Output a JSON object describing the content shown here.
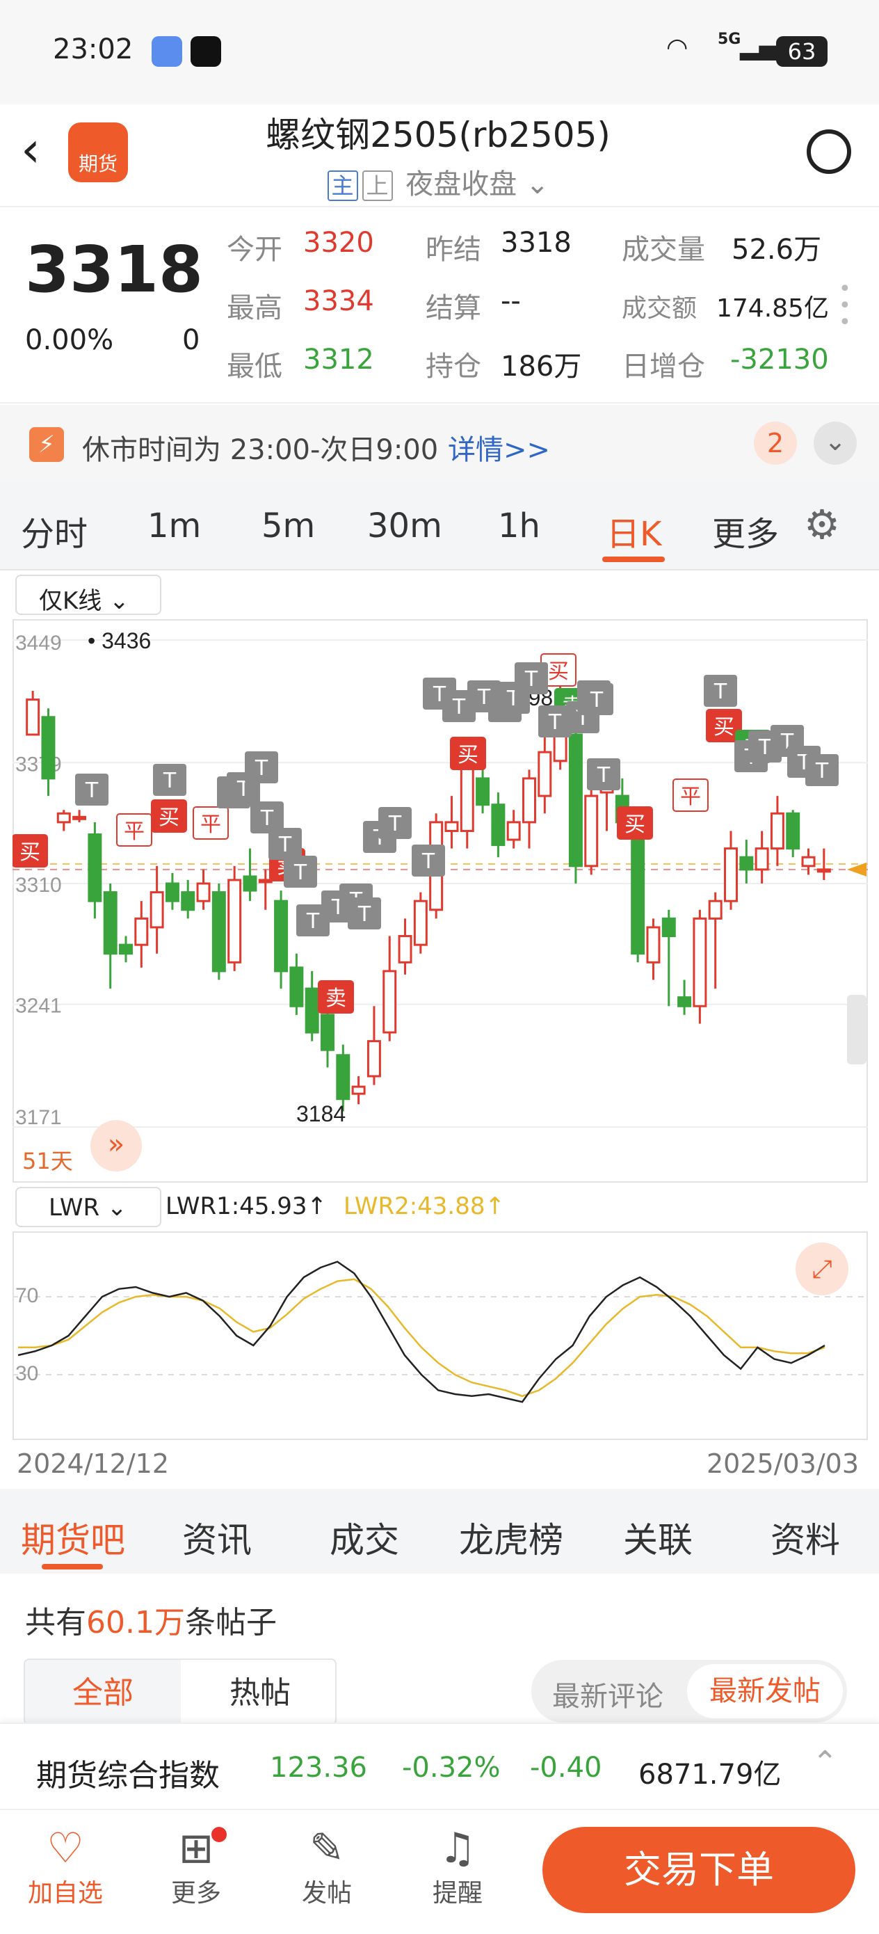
{
  "status": {
    "time": "23:02",
    "battery": "63",
    "network": "5G"
  },
  "header": {
    "title": "螺纹钢2505(rb2505)",
    "tag_main": "主",
    "tag_up": "上",
    "session": "夜盘收盘",
    "logo_text": "期货"
  },
  "quote": {
    "price": "3318",
    "change_pct": "0.00%",
    "change": "0",
    "open_label": "今开",
    "open": "3320",
    "prev_label": "昨结",
    "prev": "3318",
    "vol_label": "成交量",
    "vol": "52.6万",
    "high_label": "最高",
    "high": "3334",
    "settle_label": "结算",
    "settle": "--",
    "amt_label": "成交额",
    "amt": "174.85亿",
    "low_label": "最低",
    "low": "3312",
    "oi_label": "持仓",
    "oi": "186万",
    "oichg_label": "日增仓",
    "oichg": "-32130"
  },
  "notice": {
    "text": "休市时间为 23:00-次日9:00",
    "link": "详情>>",
    "badge": "2"
  },
  "period_tabs": [
    "分时",
    "1m",
    "5m",
    "30m",
    "1h",
    "日K",
    "更多"
  ],
  "chart_mode": "仅K线",
  "chart_data": {
    "type": "candlestick",
    "y_ticks": [
      "3449",
      "3379",
      "3310",
      "3241",
      "3171"
    ],
    "ylim": [
      3171,
      3449
    ],
    "high_label": "3436",
    "low_label": "3184",
    "mid_label": "3398",
    "days": "51天",
    "markers": [
      "买",
      "卖",
      "平",
      "T"
    ],
    "candles": [
      [
        3395,
        3415,
        3420,
        3400
      ],
      [
        3405,
        3370,
        3410,
        3360
      ],
      [
        3345,
        3350,
        3352,
        3340
      ],
      [
        3348,
        3348,
        3352,
        3345
      ],
      [
        3338,
        3300,
        3345,
        3290
      ],
      [
        3305,
        3270,
        3310,
        3250
      ],
      [
        3275,
        3270,
        3280,
        3265
      ],
      [
        3275,
        3290,
        3300,
        3262
      ],
      [
        3285,
        3305,
        3320,
        3270
      ],
      [
        3310,
        3300,
        3316,
        3295
      ],
      [
        3305,
        3295,
        3312,
        3290
      ],
      [
        3300,
        3310,
        3318,
        3295
      ],
      [
        3305,
        3260,
        3310,
        3255
      ],
      [
        3265,
        3312,
        3320,
        3260
      ],
      [
        3314,
        3306,
        3330,
        3300
      ],
      [
        3312,
        3312,
        3318,
        3295
      ],
      [
        3300,
        3260,
        3306,
        3250
      ],
      [
        3262,
        3240,
        3270,
        3235
      ],
      [
        3250,
        3225,
        3260,
        3220
      ],
      [
        3235,
        3215,
        3244,
        3205
      ],
      [
        3212,
        3187,
        3218,
        3180
      ],
      [
        3190,
        3194,
        3200,
        3184
      ],
      [
        3200,
        3220,
        3240,
        3195
      ],
      [
        3225,
        3260,
        3280,
        3220
      ],
      [
        3265,
        3280,
        3290,
        3258
      ],
      [
        3275,
        3300,
        3305,
        3270
      ],
      [
        3295,
        3345,
        3350,
        3290
      ],
      [
        3340,
        3345,
        3360,
        3330
      ],
      [
        3340,
        3380,
        3390,
        3330
      ],
      [
        3370,
        3355,
        3376,
        3350
      ],
      [
        3355,
        3332,
        3362,
        3325
      ],
      [
        3335,
        3345,
        3352,
        3330
      ],
      [
        3345,
        3370,
        3375,
        3330
      ],
      [
        3360,
        3385,
        3395,
        3350
      ],
      [
        3380,
        3398,
        3436,
        3375
      ],
      [
        3395,
        3320,
        3410,
        3310
      ],
      [
        3320,
        3360,
        3365,
        3315
      ],
      [
        3362,
        3370,
        3375,
        3340
      ],
      [
        3360,
        3345,
        3370,
        3335
      ],
      [
        3345,
        3270,
        3350,
        3265
      ],
      [
        3265,
        3285,
        3290,
        3255
      ],
      [
        3290,
        3280,
        3295,
        3240
      ],
      [
        3245,
        3240,
        3255,
        3235
      ],
      [
        3240,
        3290,
        3295,
        3230
      ],
      [
        3290,
        3300,
        3305,
        3250
      ],
      [
        3300,
        3330,
        3340,
        3295
      ],
      [
        3325,
        3318,
        3335,
        3310
      ],
      [
        3318,
        3330,
        3340,
        3310
      ],
      [
        3330,
        3350,
        3360,
        3320
      ],
      [
        3350,
        3330,
        3352,
        3325
      ],
      [
        3320,
        3325,
        3330,
        3315
      ],
      [
        3318,
        3318,
        3330,
        3312
      ]
    ]
  },
  "indicator": {
    "name": "LWR",
    "lwr1": "LWR1:45.93↑",
    "lwr2": "LWR2:43.88↑",
    "ticks": [
      "70",
      "30"
    ],
    "date_start": "2024/12/12",
    "date_end": "2025/03/03",
    "lwr1_values": [
      40,
      42,
      45,
      50,
      60,
      70,
      74,
      75,
      72,
      70,
      72,
      68,
      60,
      50,
      45,
      55,
      70,
      80,
      85,
      88,
      82,
      70,
      55,
      40,
      30,
      22,
      20,
      19,
      20,
      18,
      16,
      28,
      38,
      45,
      60,
      70,
      76,
      80,
      75,
      68,
      60,
      50,
      40,
      33,
      44,
      38,
      36,
      40,
      45
    ],
    "lwr2_values": [
      44,
      44,
      45,
      48,
      55,
      62,
      67,
      70,
      71,
      70,
      70,
      68,
      64,
      57,
      52,
      54,
      61,
      69,
      74,
      78,
      79,
      74,
      65,
      54,
      44,
      36,
      30,
      26,
      24,
      22,
      19,
      22,
      28,
      36,
      46,
      56,
      64,
      70,
      71,
      70,
      66,
      60,
      52,
      44,
      44,
      42,
      41,
      41,
      44
    ],
    "lwr1_color": "#222222",
    "lwr2_color": "#e8b82a"
  },
  "news_tabs": [
    "期货吧",
    "资讯",
    "成交",
    "龙虎榜",
    "关联",
    "资料"
  ],
  "posts": {
    "prefix": "共有",
    "count": "60.1万",
    "suffix": "条帖子",
    "filter_all": "全部",
    "filter_hot": "热帖",
    "sort_comment": "最新评论",
    "sort_post": "最新发帖"
  },
  "index": {
    "name": "期货综合指数",
    "value": "123.36",
    "pct": "-0.32%",
    "chg": "-0.40",
    "amount": "6871.79亿"
  },
  "bottom_nav": [
    "加自选",
    "更多",
    "发帖",
    "提醒"
  ],
  "trade_button": "交易下单",
  "colors": {
    "accent": "#ee5a2a",
    "up": "#e03a2f",
    "down": "#39a43b"
  }
}
